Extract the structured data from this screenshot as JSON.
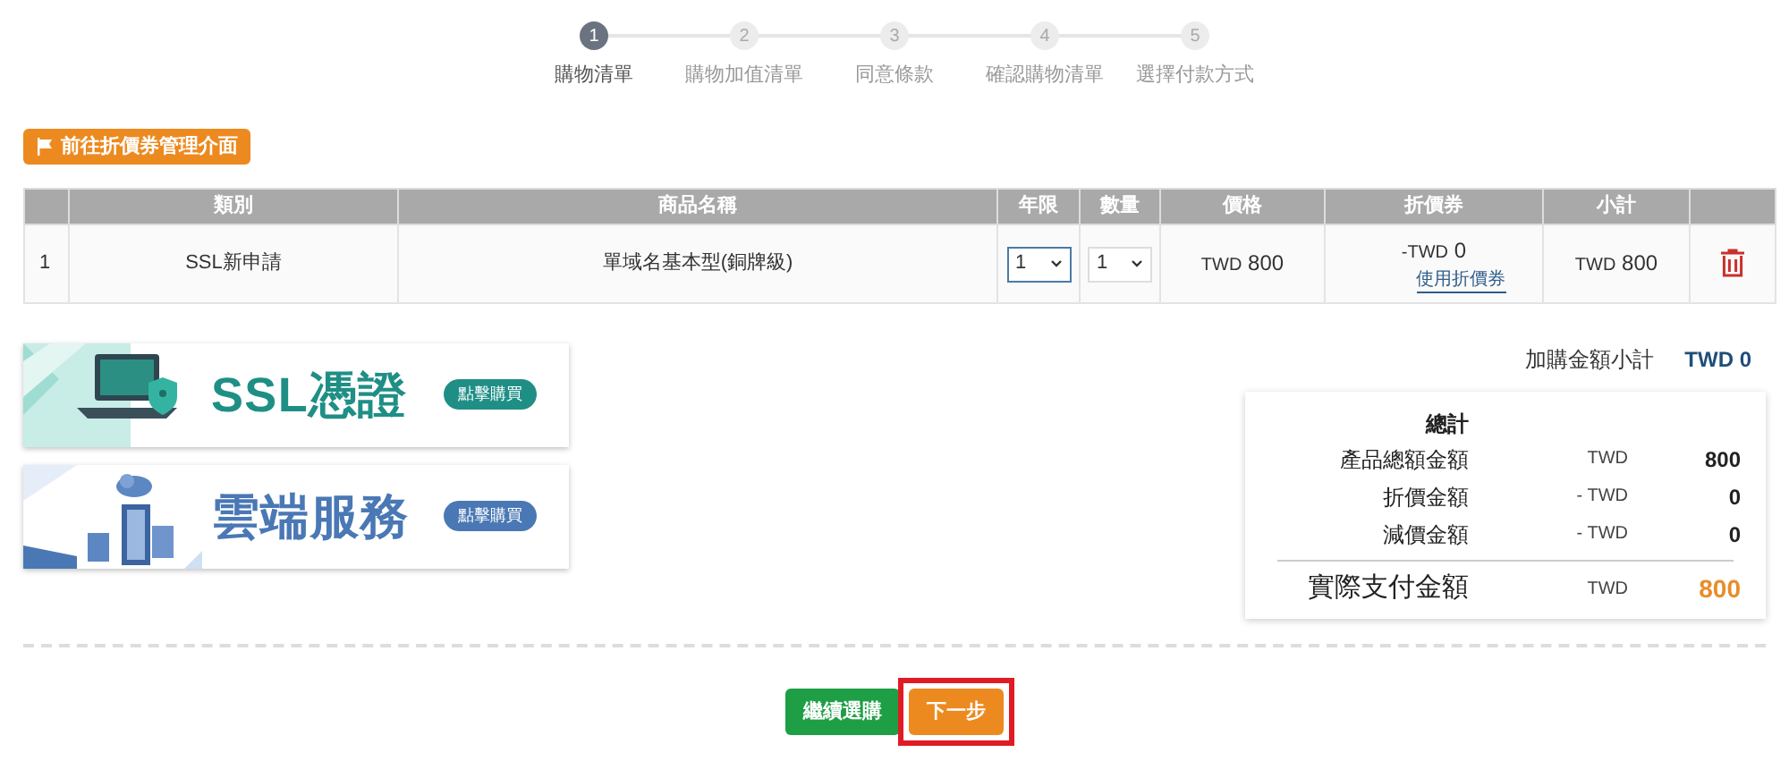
{
  "steps": [
    {
      "number": "1",
      "label": "購物清單",
      "selected": true
    },
    {
      "number": "2",
      "label": "購物加值清單",
      "selected": false
    },
    {
      "number": "3",
      "label": "同意條款",
      "selected": false
    },
    {
      "number": "4",
      "label": "確認購物清單",
      "selected": false
    },
    {
      "number": "5",
      "label": "選擇付款方式",
      "selected": false
    }
  ],
  "coupon_button": "前往折價券管理介面",
  "table": {
    "columns": [
      "",
      "類別",
      "商品名稱",
      "年限",
      "數量",
      "價格",
      "折價券",
      "小計",
      ""
    ],
    "rows": [
      {
        "index": "1",
        "category": "SSL新申請",
        "product": "單域名基本型(銅牌級)",
        "years": "1",
        "quantity": "1",
        "price_currency": "TWD",
        "price": "800",
        "coupon_currency": "-TWD",
        "coupon": "0",
        "coupon_link": "使用折價券",
        "subtotal_currency": "TWD",
        "subtotal": "800"
      }
    ]
  },
  "banners": [
    {
      "title": "SSL憑證",
      "button": "點擊購買",
      "color": "#1f8f86",
      "kind": "ssl"
    },
    {
      "title": "雲端服務",
      "button": "點擊購買",
      "color": "#4a78b5",
      "kind": "cloud"
    }
  ],
  "addon_subtotal": {
    "label": "加購金額小計",
    "value": "TWD 0"
  },
  "summary": {
    "title": "總計",
    "lines": [
      {
        "label": "產品總額金額",
        "currency": "TWD",
        "value": "800"
      },
      {
        "label": "折價金額",
        "currency": "- TWD",
        "value": "0"
      },
      {
        "label": "減價金額",
        "currency": "- TWD",
        "value": "0"
      }
    ],
    "total": {
      "label": "實際支付金額",
      "currency": "TWD",
      "value": "800"
    }
  },
  "buttons": [
    {
      "label": "繼續選購",
      "kind": "secondary",
      "highlighted": false
    },
    {
      "label": "下一步",
      "kind": "primary",
      "highlighted": true
    }
  ]
}
